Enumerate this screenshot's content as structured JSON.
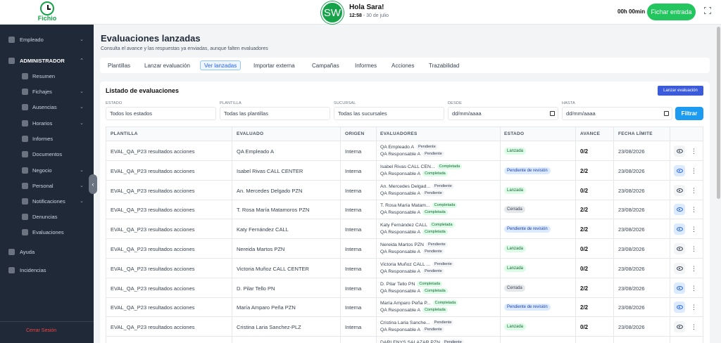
{
  "header": {
    "logo_text": "Fichio",
    "avatar_initials": "SW",
    "greeting": "Hola Sara!",
    "time": "12:58",
    "date": " - 30 de julio",
    "timer": "00h 00min",
    "clock_in_label": "Fichar entrada",
    "brand_color": "#16a34a"
  },
  "sidebar": {
    "items": [
      {
        "label": "Empleado",
        "chevron": "⌄",
        "icon": "user-icon"
      },
      {
        "label": "ADMINISTRADOR",
        "chevron": "⌃",
        "icon": "users-icon"
      },
      {
        "label": "Resumen",
        "icon": "chart-icon"
      },
      {
        "label": "Fichajes",
        "chevron": "⌄",
        "icon": "clock-icon"
      },
      {
        "label": "Ausencias",
        "chevron": "⌄",
        "icon": "calendar-icon"
      },
      {
        "label": "Horarios",
        "chevron": "⌄",
        "icon": "calendar-grid-icon"
      },
      {
        "label": "Informes",
        "icon": "report-icon"
      },
      {
        "label": "Documentos",
        "icon": "folder-icon"
      },
      {
        "label": "Negocio",
        "chevron": "⌄",
        "icon": "business-icon"
      },
      {
        "label": "Personal",
        "chevron": "⌄",
        "icon": "id-card-icon"
      },
      {
        "label": "Notificaciones",
        "chevron": "⌄",
        "icon": "bell-icon"
      },
      {
        "label": "Denuncias",
        "icon": "report-flag-icon"
      },
      {
        "label": "Evaluaciones",
        "icon": "evaluation-icon"
      },
      {
        "label": "Ayuda",
        "icon": "book-icon"
      },
      {
        "label": "Incidencias",
        "icon": "headset-icon"
      }
    ],
    "logout_label": "Cerrar Sesión"
  },
  "page": {
    "title": "Evaluaciones lanzadas",
    "subtitle": "Consulta el avance y las respuestas ya enviadas, aunque falten evaluadores",
    "tabs": [
      "Plantillas",
      "Lanzar evaluación",
      "Ver lanzadas",
      "Importar externa",
      "Campañas",
      "Informes",
      "Acciones",
      "Trazabilidad"
    ],
    "active_tab": "Ver lanzadas"
  },
  "list": {
    "title": "Listado de evaluaciones",
    "launch_button": "Lanzar evaluación",
    "filters": {
      "estado_label": "ESTADO",
      "estado_value": "Todos los estados",
      "plantilla_label": "PLANTILLA",
      "plantilla_value": "Todas las plantillas",
      "sucursal_label": "SUCURSAL",
      "sucursal_value": "Todas las sucursales",
      "desde_label": "DESDE",
      "desde_value": "dd/mm/aaaa",
      "hasta_label": "HASTA",
      "hasta_value": "dd/mm/aaaa",
      "filter_button": "Filtrar"
    },
    "columns": [
      "PLANTILLA",
      "EVALUADO",
      "ORIGEN",
      "EVALUADORES",
      "ESTADO",
      "AVANCE",
      "FECHA LÍMITE"
    ],
    "rows": [
      {
        "plantilla": "EVAL_QA_P23 resultados acciones",
        "evaluado": "QA Empleado A",
        "origen": "Interna",
        "ev1": "QA Empleado A",
        "ev1_status": "Pendiente",
        "ev1_type": "pend",
        "ev2": "QA Responsable A",
        "ev2_status": "Pendiente",
        "ev2_type": "pend",
        "estado": "Lanzada",
        "estado_type": "lanzada",
        "avance": "0/2",
        "fecha": "23/08/2026",
        "eye": "gray"
      },
      {
        "plantilla": "EVAL_QA_P23 resultados acciones",
        "evaluado": "Isabel Rivas CALL CENTER",
        "origen": "Interna",
        "ev1": "Isabel Rivas CALL CEN...",
        "ev1_status": "Completada",
        "ev1_type": "comp",
        "ev2": "QA Responsable A",
        "ev2_status": "Completada",
        "ev2_type": "comp",
        "estado": "Pendiente de revisión",
        "estado_type": "pend",
        "avance": "2/2",
        "fecha": "23/08/2026",
        "eye": "blue"
      },
      {
        "plantilla": "EVAL_QA_P23 resultados acciones",
        "evaluado": "An. Mercedes Delgado PZN",
        "origen": "Interna",
        "ev1": "An. Mercedes Delgad...",
        "ev1_status": "Pendiente",
        "ev1_type": "pend",
        "ev2": "QA Responsable A",
        "ev2_status": "Pendiente",
        "ev2_type": "pend",
        "estado": "Lanzada",
        "estado_type": "lanzada",
        "avance": "0/2",
        "fecha": "23/08/2026",
        "eye": "gray"
      },
      {
        "plantilla": "EVAL_QA_P23 resultados acciones",
        "evaluado": "T. Rosa María Matamoros PZN",
        "origen": "Interna",
        "ev1": "T. Rosa María Matam...",
        "ev1_status": "Completada",
        "ev1_type": "comp",
        "ev2": "QA Responsable A",
        "ev2_status": "Completada",
        "ev2_type": "comp",
        "estado": "Cerrada",
        "estado_type": "cerrada",
        "avance": "2/2",
        "fecha": "23/08/2026",
        "eye": "blue"
      },
      {
        "plantilla": "EVAL_QA_P23 resultados acciones",
        "evaluado": "Katy Fernández CALL",
        "origen": "Interna",
        "ev1": "Katy Fernández CALL",
        "ev1_status": "Completada",
        "ev1_type": "comp",
        "ev2": "QA Responsable A",
        "ev2_status": "Completada",
        "ev2_type": "comp",
        "estado": "Pendiente de revisión",
        "estado_type": "pend",
        "avance": "2/2",
        "fecha": "23/08/2026",
        "eye": "blue"
      },
      {
        "plantilla": "EVAL_QA_P23 resultados acciones",
        "evaluado": "Nereida Martos PZN",
        "origen": "Interna",
        "ev1": "Nereida Martos PZN",
        "ev1_status": "Pendiente",
        "ev1_type": "pend",
        "ev2": "QA Responsable A",
        "ev2_status": "Pendiente",
        "ev2_type": "pend",
        "estado": "Lanzada",
        "estado_type": "lanzada",
        "avance": "0/2",
        "fecha": "23/08/2026",
        "eye": "gray"
      },
      {
        "plantilla": "EVAL_QA_P23 resultados acciones",
        "evaluado": "Victoria Muñoz CALL CENTER",
        "origen": "Interna",
        "ev1": "Victoria Muñoz CALL ...",
        "ev1_status": "Pendiente",
        "ev1_type": "pend",
        "ev2": "QA Responsable A",
        "ev2_status": "Pendiente",
        "ev2_type": "pend",
        "estado": "Lanzada",
        "estado_type": "lanzada",
        "avance": "0/2",
        "fecha": "23/08/2026",
        "eye": "gray"
      },
      {
        "plantilla": "EVAL_QA_P23 resultados acciones",
        "evaluado": "D. Pilar Tello PN",
        "origen": "Interna",
        "ev1": "D. Pilar Tello PN",
        "ev1_status": "Completada",
        "ev1_type": "comp",
        "ev2": "QA Responsable A",
        "ev2_status": "Completada",
        "ev2_type": "comp",
        "estado": "Cerrada",
        "estado_type": "cerrada",
        "avance": "2/2",
        "fecha": "23/08/2026",
        "eye": "blue"
      },
      {
        "plantilla": "EVAL_QA_P23 resultados acciones",
        "evaluado": "María Amparo Peña PZN",
        "origen": "Interna",
        "ev1": "María Amparo Peña P...",
        "ev1_status": "Completada",
        "ev1_type": "comp",
        "ev2": "QA Responsable A",
        "ev2_status": "Completada",
        "ev2_type": "comp",
        "estado": "Pendiente de revisión",
        "estado_type": "pend",
        "avance": "2/2",
        "fecha": "23/08/2026",
        "eye": "blue"
      },
      {
        "plantilla": "EVAL_QA_P23 resultados acciones",
        "evaluado": "Cristina Laria Sanchez-PLZ",
        "origen": "Interna",
        "ev1": "Cristina Laria Sanche...",
        "ev1_status": "Pendiente",
        "ev1_type": "pend",
        "ev2": "QA Responsable A",
        "ev2_status": "Pendiente",
        "ev2_type": "pend",
        "estado": "Lanzada",
        "estado_type": "lanzada",
        "avance": "0/2",
        "fecha": "23/08/2026",
        "eye": "gray"
      },
      {
        "plantilla": "",
        "evaluado": "",
        "origen": "",
        "ev1": "DARLENYS SALAZAR PZN",
        "ev1_status": "Pendiente",
        "ev1_type": "pend",
        "ev2": "",
        "ev2_status": "",
        "ev2_type": "pend",
        "estado": "",
        "estado_type": "lanzada",
        "avance": "",
        "fecha": "",
        "eye": "gray"
      }
    ]
  }
}
